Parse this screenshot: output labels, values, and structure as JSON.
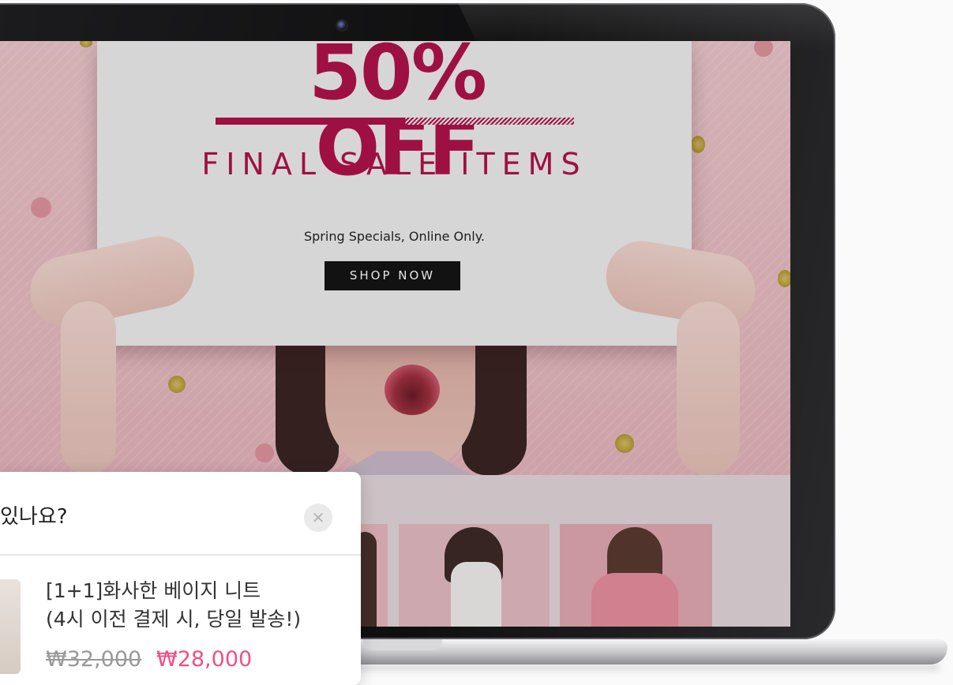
{
  "banner": {
    "headline": "50% OFF",
    "subheadline": "FINAL SALE ITEMS",
    "tagline": "Spring Specials, Online Only.",
    "cta_label": "SHOP NOW"
  },
  "popup": {
    "title": "있나요?",
    "close_icon": "close-icon",
    "product_name_line1": "[1+1]화사한 베이지 니트",
    "product_name_line2": "(4시 이전 결제 시, 당일 발송!)",
    "original_price": "₩32,000",
    "sale_price": "₩28,000"
  },
  "colors": {
    "accent": "#b2124a",
    "sale_price": "#f04f86",
    "button_bg": "#151515"
  }
}
